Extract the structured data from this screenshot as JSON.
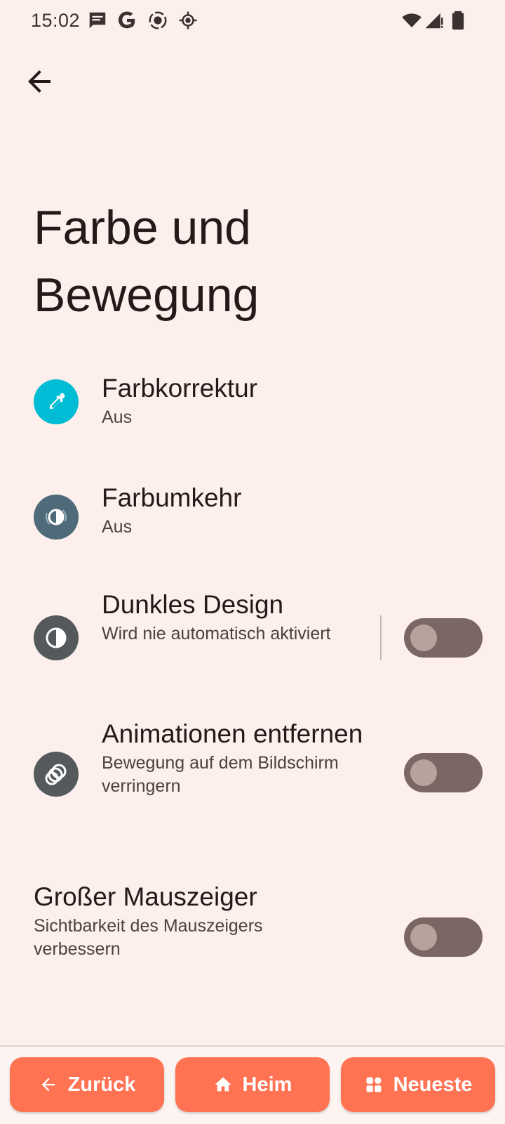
{
  "status_bar": {
    "time": "15:02",
    "icons": [
      "message-icon",
      "google-icon",
      "screen-record-icon",
      "location-icon",
      "wifi-icon",
      "signal-icon",
      "battery-icon"
    ]
  },
  "header": {
    "back_icon": "back-arrow-icon",
    "title": "Farbe und Bewegung"
  },
  "settings": {
    "items": [
      {
        "title": "Farbkorrektur",
        "subtitle": "Aus",
        "icon": "eyedropper-icon",
        "icon_color": "#00bcd4"
      },
      {
        "title": "Farbumkehr",
        "subtitle": "Aus",
        "icon": "color-inversion-icon",
        "icon_color": "#4f6b7a"
      },
      {
        "title": "Dunkles Design",
        "subtitle": "Wird nie automatisch aktiviert",
        "icon": "dark-theme-icon",
        "icon_color": "#55595c",
        "toggle": false
      },
      {
        "title": "Animationen entfernen",
        "subtitle": "Bewegung auf dem Bildschirm verringern",
        "icon": "animation-icon",
        "icon_color": "#55595c",
        "toggle": false
      },
      {
        "title": "Großer Mauszeiger",
        "subtitle": "Sichtbarkeit des Mauszeigers verbessern",
        "toggle": false
      }
    ]
  },
  "bottom_nav": {
    "back_label": "Zurück",
    "home_label": "Heim",
    "recents_label": "Neueste",
    "accent": "#ff7252"
  }
}
